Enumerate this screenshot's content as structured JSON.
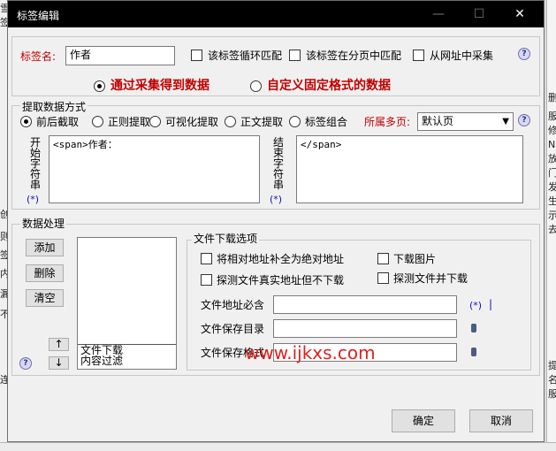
{
  "window": {
    "title": "标签编辑",
    "minimize_glyph": "—",
    "maximize_glyph": "☐",
    "close_glyph": "✕"
  },
  "label_name": {
    "label": "标签名:",
    "value": "作者"
  },
  "options": {
    "loop_match": "该标签循环匹配",
    "page_match": "该标签在分页中匹配",
    "from_url": "从网址中采集"
  },
  "source_mode": {
    "collect": "通过采集得到数据",
    "custom": "自定义固定格式的数据",
    "selected": "collect"
  },
  "extract": {
    "title": "提取数据方式",
    "modes": [
      "前后截取",
      "正则提取",
      "可视化提取",
      "正文提取",
      "标签组合"
    ],
    "selected_index": 0,
    "multi_page_label": "所属多页:",
    "multi_page_value": "默认页",
    "start_label": "开始字符串",
    "start_value": "<span>作者：",
    "end_label": "结束字符串",
    "end_value": "</span>",
    "wildcard_link": "(*)"
  },
  "processing": {
    "title": "数据处理",
    "add": "添加",
    "delete": "删除",
    "clear": "清空",
    "items": [
      "文件下载",
      "内容过滤"
    ],
    "up": "↑",
    "down": "↓"
  },
  "download": {
    "title": "文件下载选项",
    "abs_url": "将相对地址补全为绝对地址",
    "download_images": "下载图片",
    "detect_no_download": "探测文件真实地址但不下载",
    "detect_and_download": "探测文件并下载",
    "url_must_contain": "文件地址必含",
    "url_must_contain_value": "",
    "save_dir": "文件保存目录",
    "save_dir_value": "",
    "save_format": "文件保存格式",
    "save_format_value": "",
    "wildcard_link": "(*)",
    "separator": "|"
  },
  "footer": {
    "ok": "确定",
    "cancel": "取消"
  },
  "watermark": "www.ijkxs.com",
  "colors": {
    "accent_red": "#c00000",
    "watermark_red": "#e02020",
    "titlebar": "#000000"
  },
  "background_fragments": {
    "left": [
      "雪",
      "签",
      "创",
      "则",
      "签",
      "内",
      "漏",
      "不",
      "连"
    ],
    "right": [
      "删",
      "服",
      "修",
      "N",
      "放",
      "门",
      "发",
      "生",
      "示",
      "去",
      "提",
      "名",
      "服"
    ]
  }
}
